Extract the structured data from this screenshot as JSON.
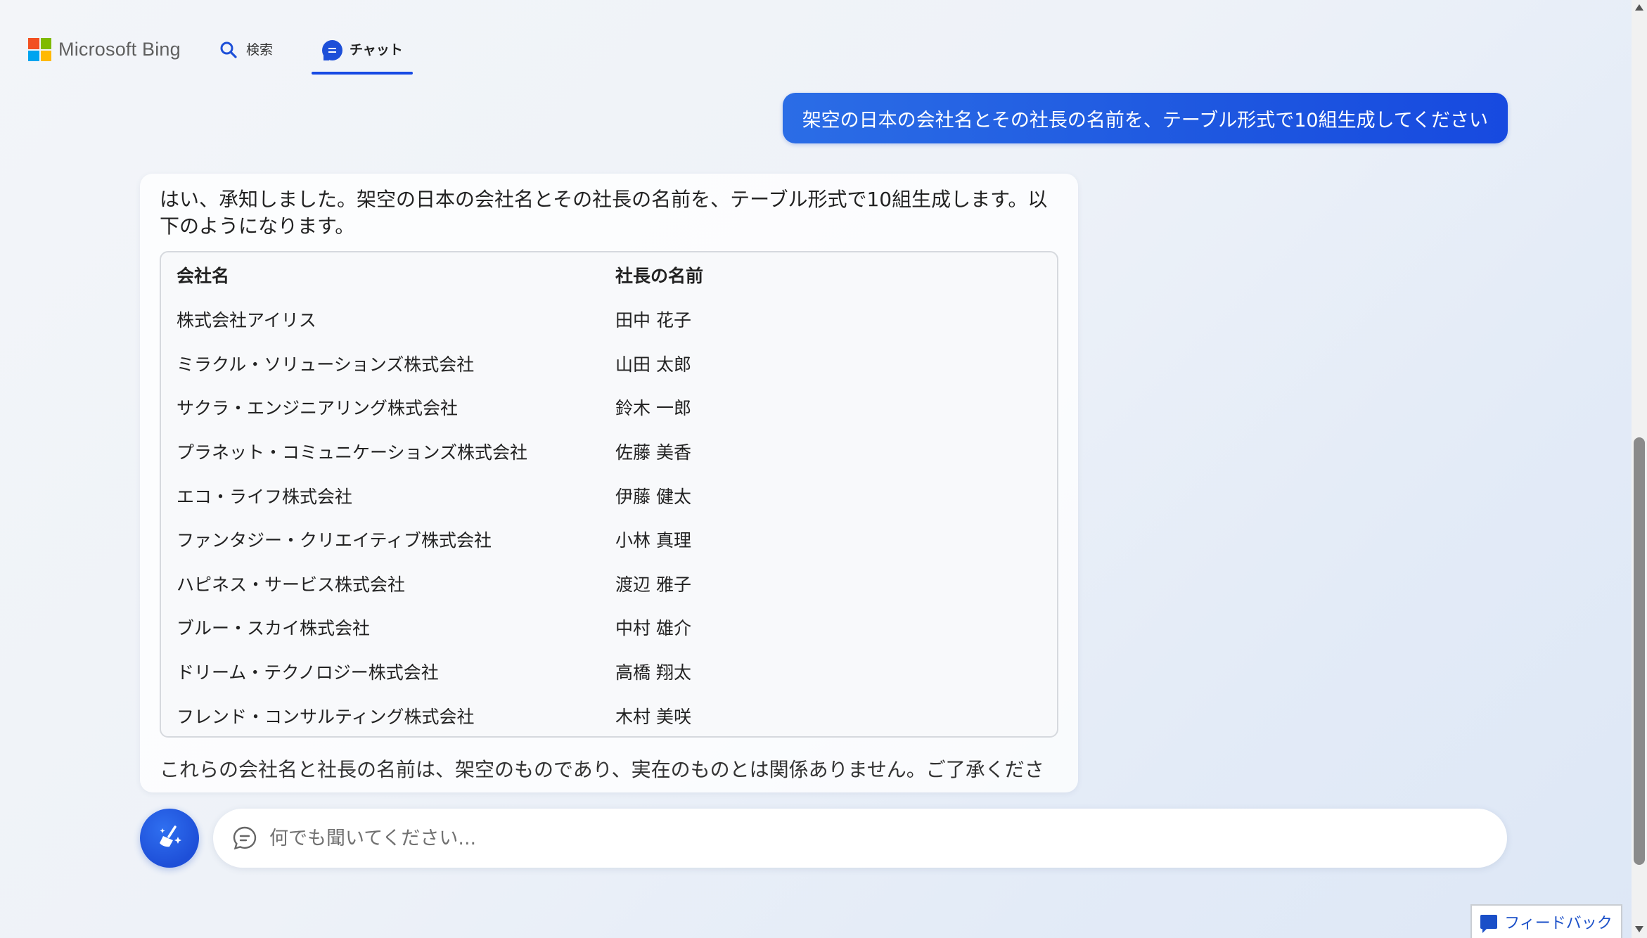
{
  "header": {
    "logo_text": "Microsoft Bing",
    "logo_colors": [
      "#f25022",
      "#7fba00",
      "#00a4ef",
      "#ffb900"
    ],
    "tabs": [
      {
        "label": "検索",
        "icon": "search-icon"
      },
      {
        "label": "チャット",
        "icon": "chat-icon",
        "active": true
      }
    ]
  },
  "conversation": {
    "user_message": "架空の日本の会社名とその社長の名前を、テーブル形式で10組生成してください",
    "bot_intro": "はい、承知しました。架空の日本の会社名とその社長の名前を、テーブル形式で10組生成します。以下のようになります。",
    "table": {
      "headers": [
        "会社名",
        "社長の名前"
      ],
      "rows": [
        [
          "株式会社アイリス",
          "田中 花子"
        ],
        [
          "ミラクル・ソリューションズ株式会社",
          "山田 太郎"
        ],
        [
          "サクラ・エンジニアリング株式会社",
          "鈴木 一郎"
        ],
        [
          "プラネット・コミュニケーションズ株式会社",
          "佐藤 美香"
        ],
        [
          "エコ・ライフ株式会社",
          "伊藤 健太"
        ],
        [
          "ファンタジー・クリエイティブ株式会社",
          "小林 真理"
        ],
        [
          "ハピネス・サービス株式会社",
          "渡辺 雅子"
        ],
        [
          "ブルー・スカイ株式会社",
          "中村 雄介"
        ],
        [
          "ドリーム・テクノロジー株式会社",
          "高橋 翔太"
        ],
        [
          "フレンド・コンサルティング株式会社",
          "木村 美咲"
        ]
      ]
    },
    "bot_outro": "これらの会社名と社長の名前は、架空のものであり、実在のものとは関係ありません。ご了承くださ"
  },
  "composer": {
    "placeholder": "何でも聞いてください...",
    "new_topic_icon": "broom-sparkle-icon"
  },
  "feedback": {
    "label": "フィードバック"
  },
  "colors": {
    "accent": "#174ae4",
    "user_bubble": "#1e57e0"
  }
}
